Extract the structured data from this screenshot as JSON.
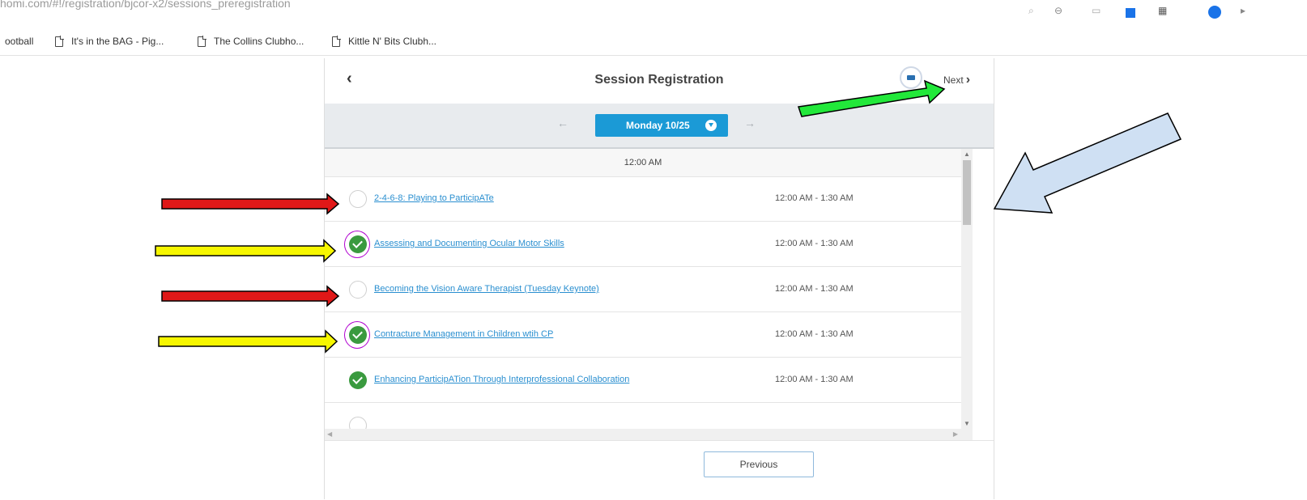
{
  "browser": {
    "url": "homi.com/#!/registration/bjcor-x2/sessions_preregistration",
    "bookmarks": [
      {
        "label": "ootball"
      },
      {
        "label": "It's in the BAG - Pig..."
      },
      {
        "label": "The Collins Clubho..."
      },
      {
        "label": "Kittle N' Bits Clubh..."
      }
    ]
  },
  "header": {
    "back_icon": "‹",
    "title": "Session Registration",
    "next_label": "Next",
    "next_icon": "›"
  },
  "datebar": {
    "prev_icon": "←",
    "next_icon": "→",
    "selected_date": "Monday 10/25"
  },
  "timeslot": "12:00 AM",
  "sessions": [
    {
      "title": "2-4-6-8: Playing to ParticipATe",
      "time": "12:00 AM - 1:30 AM",
      "selected": false
    },
    {
      "title": "Assessing and Documenting Ocular Motor Skills",
      "time": "12:00 AM - 1:30 AM",
      "selected": true
    },
    {
      "title": "Becoming the Vision Aware Therapist (Tuesday Keynote)",
      "time": "12:00 AM - 1:30 AM",
      "selected": false
    },
    {
      "title": "Contracture Management in Children wtih CP",
      "time": "12:00 AM - 1:30 AM",
      "selected": true
    },
    {
      "title": "Enhancing ParticipATion Through Interprofessional Collaboration",
      "time": "12:00 AM - 1:30 AM",
      "selected": true
    }
  ],
  "footer": {
    "previous_label": "Previous"
  },
  "annotation_colors": {
    "red": "#e01818",
    "yellow": "#f7f700",
    "green": "#22e83a",
    "blue": "#cfe0f3"
  }
}
